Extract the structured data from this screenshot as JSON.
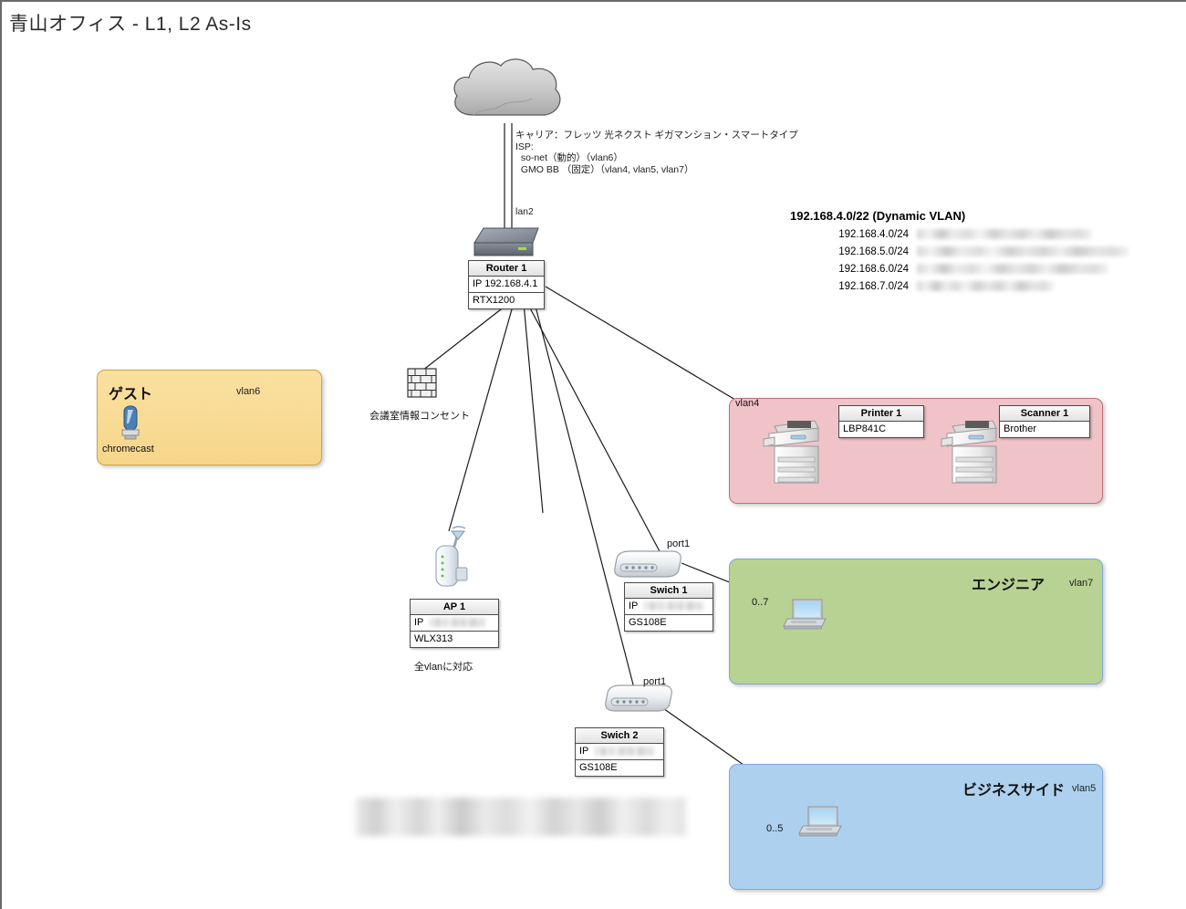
{
  "page": {
    "title": "青山オフィス - L1, L2 As-Is"
  },
  "wan": {
    "cloud_icon": "cloud-icon",
    "isp_text": "キャリア：フレッツ 光ネクスト ギガマンション・スマートタイプ\nISP:\n  so-net（動的）（vlan6）\n  GMO BB （固定）（vlan4, vlan5, vlan7）",
    "interface_label": "lan2"
  },
  "router": {
    "icon": "router-icon",
    "name": "Router 1",
    "ip": "IP 192.168.4.1",
    "model": "RTX1200"
  },
  "vlan_pool": {
    "title": "192.168.4.0/22 (Dynamic VLAN)",
    "rows": [
      {
        "cidr": "192.168.4.0/24",
        "detail": ""
      },
      {
        "cidr": "192.168.5.0/24",
        "detail": ""
      },
      {
        "cidr": "192.168.6.0/24",
        "detail": ""
      },
      {
        "cidr": "192.168.7.0/24",
        "detail": ""
      }
    ]
  },
  "guest_zone": {
    "title": "ゲスト",
    "vlan": "vlan6",
    "device_icon": "chromecast-icon",
    "device_label": "chromecast"
  },
  "meeting_room": {
    "icon": "firewall-brick-icon",
    "label": "会議室情報コンセント"
  },
  "access_point": {
    "icon": "wireless-ap-icon",
    "name": "AP 1",
    "ip_prefix": "IP",
    "ip_redacted": true,
    "model": "WLX313",
    "note": "全vlanに対応"
  },
  "switch1": {
    "icon": "switch-icon",
    "port_label": "port1",
    "name": "Swich 1",
    "ip_prefix": "IP",
    "ip_redacted": true,
    "model": "GS108E"
  },
  "switch2": {
    "icon": "switch-icon",
    "port_label": "port1",
    "name": "Swich 2",
    "ip_prefix": "IP",
    "ip_redacted": true,
    "model": "GS108E"
  },
  "printer_zone": {
    "vlan": "vlan4",
    "printer": {
      "icon": "printer-icon",
      "name": "Printer 1",
      "model": "LBP841C"
    },
    "scanner": {
      "icon": "scanner-icon",
      "name": "Scanner 1",
      "model": "Brother"
    }
  },
  "engineer_zone": {
    "title": "エンジニア",
    "vlan": "vlan7",
    "port_range": "0..7",
    "device_icon": "laptop-icon"
  },
  "business_zone": {
    "title": "ビジネスサイド",
    "vlan": "vlan5",
    "port_range": "0..5",
    "device_icon": "laptop-icon"
  },
  "redacted_note": {
    "visible": true,
    "content": ""
  },
  "colors": {
    "guest_zone": "#f6d68a",
    "guest_border": "#c9a442",
    "printer_zone": "#f0c3c8",
    "printer_border": "#c06e78",
    "engineer_zone": "#b8d293",
    "business_zone": "#aed0ef",
    "zone_border_blue": "#7fa7d9",
    "line": "#1a1a1a",
    "text": "#111111"
  }
}
